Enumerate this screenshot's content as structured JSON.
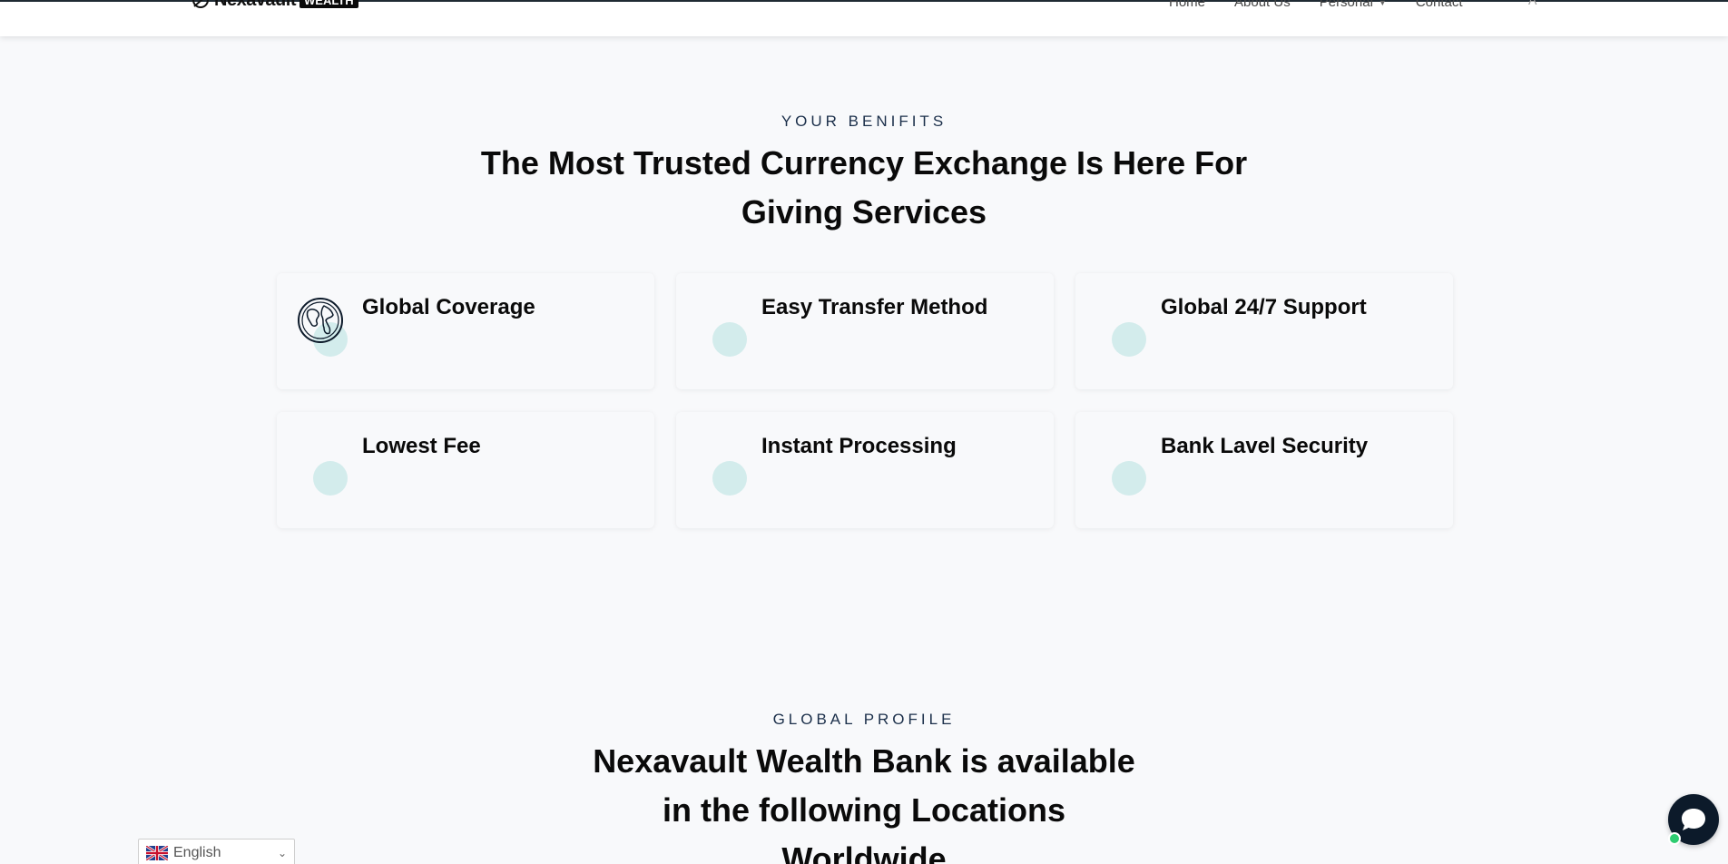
{
  "header": {
    "logo_text": "Nexavault",
    "logo_badge": "WEALTH",
    "nav": [
      {
        "label": "Home",
        "has_caret": false
      },
      {
        "label": "About Us",
        "has_caret": false
      },
      {
        "label": "Personal",
        "has_caret": true
      },
      {
        "label": "Contact",
        "has_caret": false
      }
    ],
    "nav_extra": "A"
  },
  "benefits": {
    "eyebrow": "YOUR BENIFITS",
    "title_line1": "The Most Trusted Currency Exchange Is Here For",
    "title_line2": "Giving Services",
    "cards": [
      {
        "title": "Global Coverage",
        "icon": "globe-icon"
      },
      {
        "title": "Easy Transfer Method",
        "icon": "transfer-icon"
      },
      {
        "title": "Global 24/7 Support",
        "icon": "support-icon"
      },
      {
        "title": "Lowest Fee",
        "icon": "fee-icon"
      },
      {
        "title": "Instant Processing",
        "icon": "processing-icon"
      },
      {
        "title": "Bank Lavel Security",
        "icon": "security-icon"
      }
    ],
    "icon_accent": "#d3ecec"
  },
  "profile": {
    "eyebrow": "GLOBAL PROFILE",
    "title_line1": "Nexavault Wealth Bank is available",
    "title_line2": "in the following Locations",
    "title_line3": "Worldwide"
  },
  "language": {
    "selected": "English",
    "flag_icon": "uk-flag-icon"
  },
  "chat": {
    "icon": "chat-bubble-icon",
    "status_color": "#2ecc71"
  }
}
